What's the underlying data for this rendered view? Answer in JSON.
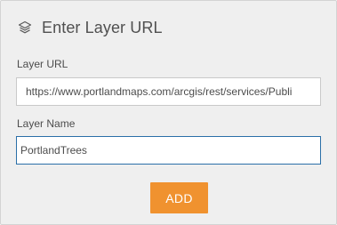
{
  "header": {
    "title": "Enter Layer URL",
    "icon": "layers-icon"
  },
  "form": {
    "url_label": "Layer URL",
    "url_value": "https://www.portlandmaps.com/arcgis/rest/services/Publi",
    "name_label": "Layer Name",
    "name_value": "PortlandTrees",
    "add_label": "ADD"
  },
  "colors": {
    "accent": "#f0922f",
    "focus_border": "#2b6fa8",
    "panel_bg": "#efefef"
  }
}
